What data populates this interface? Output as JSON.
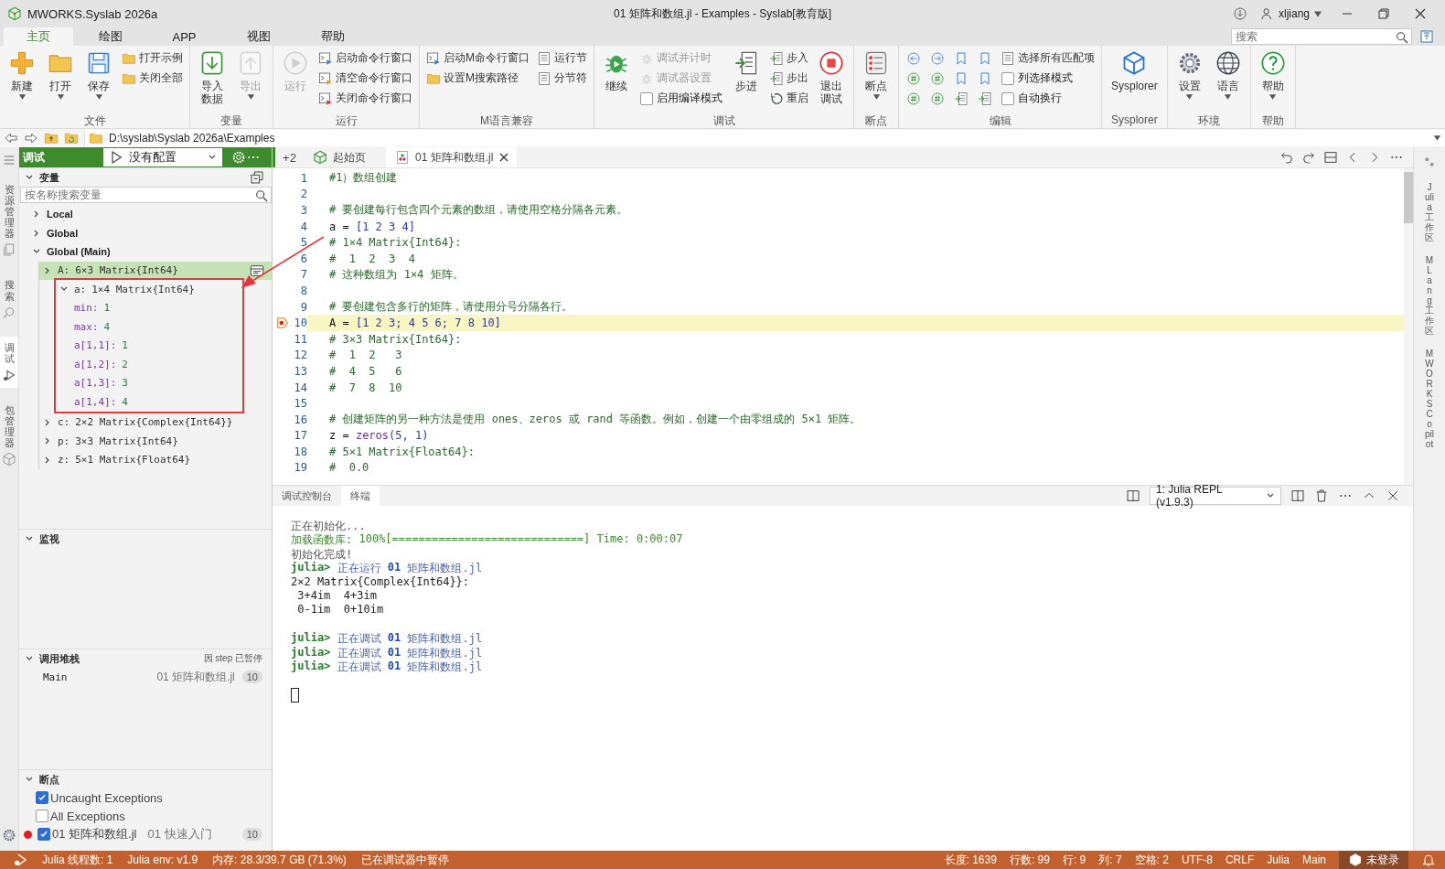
{
  "window": {
    "app_name": "MWORKS.Syslab 2026a",
    "title": "01 矩阵和数组.jl - Examples - Syslab[教育版]",
    "user": "xljiang"
  },
  "ribbon_tabs": [
    {
      "label": "主页",
      "selected": true
    },
    {
      "label": "绘图",
      "selected": false
    },
    {
      "label": "APP",
      "selected": false
    },
    {
      "label": "视图",
      "selected": false
    },
    {
      "label": "帮助",
      "selected": false
    }
  ],
  "ribbon_search": {
    "placeholder": "搜索"
  },
  "ribbon": [
    {
      "label": "文件",
      "columns": [
        [
          {
            "kind": "large",
            "label": "新建",
            "caret": true,
            "disabled": false
          }
        ],
        [
          {
            "kind": "large",
            "label": "打开",
            "caret": true,
            "disabled": false
          }
        ],
        [
          {
            "kind": "large",
            "label": "保存",
            "caret": true,
            "disabled": false
          }
        ],
        [
          {
            "kind": "small",
            "label": "打开示例",
            "disabled": false
          },
          {
            "kind": "small",
            "label": "关闭全部",
            "disabled": false
          }
        ]
      ]
    },
    {
      "label": "变量",
      "columns": [
        [
          {
            "kind": "large",
            "label": "导入",
            "label_2": "数据",
            "caret": false,
            "disabled": false
          }
        ],
        [
          {
            "kind": "large",
            "label": "导出",
            "caret": true,
            "disabled": true
          }
        ]
      ]
    },
    {
      "label": "运行",
      "columns": [
        [
          {
            "kind": "large",
            "label": "运行",
            "caret": false,
            "disabled": true
          }
        ],
        [
          {
            "kind": "small",
            "label": "启动命令行窗口",
            "disabled": false
          },
          {
            "kind": "small",
            "label": "清空命令行窗口",
            "disabled": false
          },
          {
            "kind": "small",
            "label": "关闭命令行窗口",
            "disabled": false
          }
        ]
      ]
    },
    {
      "label": "M语言兼容",
      "columns": [
        [
          {
            "kind": "small",
            "label": "启动M命令行窗口",
            "disabled": false
          },
          {
            "kind": "small",
            "label": "设置M搜索路径",
            "disabled": false
          }
        ],
        [
          {
            "kind": "small",
            "label": "运行节",
            "disabled": false
          },
          {
            "kind": "small",
            "label": "分节符",
            "disabled": false
          }
        ]
      ]
    },
    {
      "label": "调试",
      "columns": [
        [
          {
            "kind": "large",
            "label": "继续",
            "caret": false,
            "disabled": false
          }
        ],
        [
          {
            "kind": "small",
            "label": "调试并计时",
            "disabled": true
          },
          {
            "kind": "small",
            "label": "调试器设置",
            "disabled": true
          },
          {
            "kind": "check",
            "label": "启用编译模式",
            "checked": false,
            "disabled": false
          }
        ],
        [
          {
            "kind": "large",
            "label": "步进",
            "caret": false,
            "disabled": false
          }
        ],
        [
          {
            "kind": "small",
            "label": "步入",
            "disabled": false
          },
          {
            "kind": "small",
            "label": "步出",
            "disabled": false
          },
          {
            "kind": "small",
            "label": "重启",
            "disabled": false
          }
        ],
        [
          {
            "kind": "large",
            "label": "退出",
            "label_2": "调试",
            "caret": false,
            "disabled": false
          }
        ]
      ]
    },
    {
      "label": "断点",
      "columns": [
        [
          {
            "kind": "large",
            "label": "断点",
            "caret": true,
            "disabled": false
          }
        ]
      ]
    },
    {
      "label": "编辑",
      "columns": [
        [
          {
            "kind": "icon",
            "disabled": false
          },
          {
            "kind": "icon",
            "disabled": false
          },
          {
            "kind": "icon",
            "disabled": false
          }
        ],
        [
          {
            "kind": "icon",
            "disabled": false
          },
          {
            "kind": "icon",
            "disabled": false
          },
          {
            "kind": "icon",
            "disabled": false
          }
        ],
        [
          {
            "kind": "icon",
            "disabled": false
          },
          {
            "kind": "icon",
            "disabled": false
          },
          {
            "kind": "icon",
            "disabled": false
          }
        ],
        [
          {
            "kind": "icon",
            "disabled": false
          },
          {
            "kind": "icon",
            "disabled": false
          },
          {
            "kind": "icon",
            "disabled": false
          }
        ],
        [
          {
            "kind": "small",
            "label": "选择所有匹配项",
            "disabled": false
          },
          {
            "kind": "check",
            "label": "列选择模式",
            "checked": false,
            "disabled": false
          },
          {
            "kind": "check",
            "label": "自动换行",
            "checked": false,
            "disabled": false
          }
        ]
      ]
    },
    {
      "label": "Sysplorer",
      "columns": [
        [
          {
            "kind": "large",
            "label": "Sysplorer",
            "caret": false,
            "disabled": false
          }
        ]
      ]
    },
    {
      "label": "环境",
      "columns": [
        [
          {
            "kind": "large",
            "label": "设置",
            "caret": true,
            "disabled": false
          }
        ],
        [
          {
            "kind": "large",
            "label": "语言",
            "caret": true,
            "disabled": false
          }
        ]
      ]
    },
    {
      "label": "帮助",
      "columns": [
        [
          {
            "kind": "large",
            "label": "帮助",
            "caret": true,
            "disabled": false
          }
        ]
      ]
    }
  ],
  "address_bar": {
    "path": "D:\\syslab\\Syslab 2026a\\Examples"
  },
  "activity_bar": [
    {
      "label": "资源管理器",
      "selected": false
    },
    {
      "label": "搜索",
      "selected": false
    },
    {
      "label": "调试",
      "selected": true
    },
    {
      "label": "包管理器",
      "selected": false
    }
  ],
  "debug_panel": {
    "title": "调试",
    "config": "没有配置",
    "variables": {
      "title": "变量",
      "placeholder": "按名称搜索变量",
      "scopes": [
        {
          "label": "Local",
          "expanded": false,
          "selected": false
        },
        {
          "label": "Global",
          "expanded": false,
          "selected": false
        },
        {
          "label": "Global (Main)",
          "expanded": true,
          "selected": false,
          "children": [
            {
              "name": "A:",
              "value": "6×3 Matrix{Int64}",
              "expanded": false,
              "selected": true
            },
            {
              "name": "a:",
              "value": "1×4 Matrix{Int64}",
              "expanded": true,
              "selected": false,
              "children": [
                {
                  "name": "min:",
                  "value": "1",
                  "selected": false
                },
                {
                  "name": "max:",
                  "value": "4",
                  "selected": false
                },
                {
                  "name": "a[1,1]:",
                  "value": "1",
                  "selected": false
                },
                {
                  "name": "a[1,2]:",
                  "value": "2",
                  "selected": false
                },
                {
                  "name": "a[1,3]:",
                  "value": "3",
                  "selected": false
                },
                {
                  "name": "a[1,4]:",
                  "value": "4",
                  "selected": false
                }
              ]
            },
            {
              "name": "c:",
              "value": "2×2 Matrix{Complex{Int64}}",
              "expanded": false,
              "selected": false
            },
            {
              "name": "p:",
              "value": "3×3 Matrix{Int64}",
              "expanded": false,
              "selected": false
            },
            {
              "name": "z:",
              "value": "5×1 Matrix{Float64}",
              "expanded": false,
              "selected": false
            }
          ]
        }
      ]
    },
    "watch": {
      "title": "监视"
    },
    "call_stack": {
      "title": "调用堆栈",
      "note": "因 step 已暂停",
      "frames": [
        {
          "name": "Main",
          "file": "01 矩阵和数组.jl",
          "line": "10"
        }
      ]
    },
    "breakpoints": {
      "title": "断点",
      "items": [
        {
          "kind": "exception",
          "label": "Uncaught Exceptions",
          "checked": true
        },
        {
          "kind": "exception",
          "label": "All Exceptions",
          "checked": false
        },
        {
          "kind": "file",
          "label": "01 矩阵和数组.jl",
          "folder": "01 快速入门",
          "line": "10",
          "checked": true
        }
      ]
    }
  },
  "editor": {
    "overflow": "+2",
    "tabs": [
      {
        "label": "起始页",
        "selected": false
      },
      {
        "label": "01 矩阵和数组.jl",
        "selected": true
      }
    ],
    "lines": [
      {
        "n": "1",
        "current": false,
        "tokens": [
          {
            "text": "#1）数组创建",
            "kind": "comment"
          }
        ]
      },
      {
        "n": "2",
        "current": false
      },
      {
        "n": "3",
        "current": false,
        "tokens": [
          {
            "text": "# 要创建每行包含四个元素的数组，请使用空格分隔各元素。",
            "kind": "comment"
          }
        ]
      },
      {
        "n": "4",
        "current": false,
        "tokens": [
          {
            "text": "a = ",
            "kind": "plain"
          },
          {
            "text": "[1 2 3 4]",
            "kind": "number"
          }
        ]
      },
      {
        "n": "5",
        "current": false,
        "tokens": [
          {
            "text": "# 1×4 Matrix{Int64}:",
            "kind": "comment"
          }
        ]
      },
      {
        "n": "6",
        "current": false,
        "tokens": [
          {
            "text": "#  1  2  3  4",
            "kind": "comment"
          }
        ]
      },
      {
        "n": "7",
        "current": false,
        "tokens": [
          {
            "text": "# 这种数组为 1×4 矩阵。",
            "kind": "comment"
          }
        ]
      },
      {
        "n": "8",
        "current": false
      },
      {
        "n": "9",
        "current": false,
        "tokens": [
          {
            "text": "# 要创建包含多行的矩阵，请使用分号分隔各行。",
            "kind": "comment"
          }
        ]
      },
      {
        "n": "10",
        "current": true,
        "tokens": [
          {
            "text": "A = ",
            "kind": "plain"
          },
          {
            "text": "[1 2 3; 4 5 6; 7 8 10]",
            "kind": "number"
          }
        ]
      },
      {
        "n": "11",
        "current": false,
        "tokens": [
          {
            "text": "# 3×3 Matrix{Int64}:",
            "kind": "comment"
          }
        ]
      },
      {
        "n": "12",
        "current": false,
        "tokens": [
          {
            "text": "#  1  2   3",
            "kind": "comment"
          }
        ]
      },
      {
        "n": "13",
        "current": false,
        "tokens": [
          {
            "text": "#  4  5   6",
            "kind": "comment"
          }
        ]
      },
      {
        "n": "14",
        "current": false,
        "tokens": [
          {
            "text": "#  7  8  10",
            "kind": "comment"
          }
        ]
      },
      {
        "n": "15",
        "current": false
      },
      {
        "n": "16",
        "current": false,
        "tokens": [
          {
            "text": "# 创建矩阵的另一种方法是使用 ones、zeros 或 rand 等函数。例如，创建一个由零组成的 5×1 矩阵。",
            "kind": "comment"
          }
        ]
      },
      {
        "n": "17",
        "current": false,
        "tokens": [
          {
            "text": "z = ",
            "kind": "plain"
          },
          {
            "text": "zeros",
            "kind": "func"
          },
          {
            "text": "(5, 1)",
            "kind": "number"
          }
        ]
      },
      {
        "n": "18",
        "current": false,
        "tokens": [
          {
            "text": "# 5×1 Matrix{Float64}:",
            "kind": "comment"
          }
        ]
      },
      {
        "n": "19",
        "current": false,
        "tokens": [
          {
            "text": "#  0.0",
            "kind": "comment"
          }
        ]
      }
    ]
  },
  "panel": {
    "tabs": [
      {
        "label": "调试控制台",
        "selected": false
      },
      {
        "label": "终端",
        "selected": true
      }
    ],
    "terminal_select": "1: Julia REPL (v1.9.3)",
    "blocks": [
      [
        [
          {
            "text": "正在初始化...",
            "kind": "muted"
          }
        ],
        [
          {
            "text": "加载函数库: ",
            "kind": "green"
          },
          {
            "text": "100%[=============================] Time: 0:00:07",
            "kind": "green"
          }
        ],
        [
          {
            "text": "初始化完成!",
            "kind": "muted"
          }
        ],
        [
          {
            "text": "julia>",
            "kind": "prompt"
          },
          {
            "text": " 正在运行 ",
            "kind": "path"
          },
          {
            "text": "01",
            "kind": "num"
          },
          {
            "text": " 矩阵和数组.jl",
            "kind": "path"
          }
        ],
        [
          {
            "text": "2×2 Matrix{Complex{Int64}}:",
            "kind": "plain"
          }
        ],
        [
          {
            "text": " 3+4im  4+3im",
            "kind": "plain"
          }
        ],
        [
          {
            "text": " 0-1im  0+10im",
            "kind": "plain"
          }
        ]
      ],
      [
        [
          {
            "text": "julia>",
            "kind": "prompt"
          },
          {
            "text": " 正在调试 ",
            "kind": "path"
          },
          {
            "text": "01",
            "kind": "num"
          },
          {
            "text": " 矩阵和数组.jl",
            "kind": "path"
          }
        ],
        [
          {
            "text": "julia>",
            "kind": "prompt"
          },
          {
            "text": " 正在调试 ",
            "kind": "path"
          },
          {
            "text": "01",
            "kind": "num"
          },
          {
            "text": " 矩阵和数组.jl",
            "kind": "path"
          }
        ],
        [
          {
            "text": "julia>",
            "kind": "prompt"
          },
          {
            "text": " 正在调试 ",
            "kind": "path"
          },
          {
            "text": "01",
            "kind": "num"
          },
          {
            "text": " 矩阵和数组.jl",
            "kind": "path"
          }
        ]
      ]
    ]
  },
  "right_bar": [
    "Julia 工作区",
    "MLang 工作区",
    "MWORKS Copilot"
  ],
  "status_bar": {
    "left": [
      "Julia 线程数: 1",
      "Julia env: v1.9",
      "内存: 28.3/39.7 GB (71.3%)",
      "已在调试器中暂停"
    ],
    "right": [
      "长度: 1639",
      "行数: 99",
      "行: 9",
      "列: 7",
      "空格: 2",
      "UTF-8",
      "CRLF",
      "Julia",
      "Main"
    ],
    "account": "未登录"
  }
}
